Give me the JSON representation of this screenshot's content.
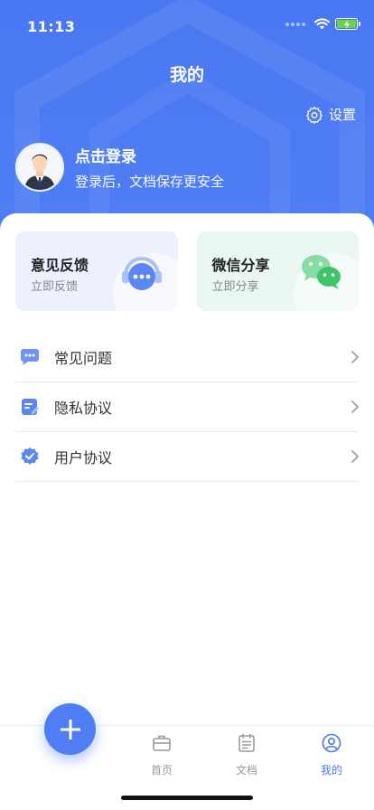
{
  "status_bar": {
    "time": "11:13"
  },
  "header": {
    "title": "我的",
    "settings_label": "设置"
  },
  "profile": {
    "title": "点击登录",
    "subtitle": "登录后，文档保存更安全"
  },
  "cards": [
    {
      "title": "意见反馈",
      "subtitle": "立即反馈",
      "icon": "headset-chat-icon"
    },
    {
      "title": "微信分享",
      "subtitle": "立即分享",
      "icon": "wechat-icon"
    }
  ],
  "menu": [
    {
      "label": "常见问题",
      "icon": "faq-chat-icon"
    },
    {
      "label": "隐私协议",
      "icon": "document-edit-icon"
    },
    {
      "label": "用户协议",
      "icon": "verified-badge-icon"
    }
  ],
  "tabs": [
    {
      "label": "首页",
      "icon": "briefcase-icon",
      "active": false
    },
    {
      "label": "文档",
      "icon": "calendar-doc-icon",
      "active": false
    },
    {
      "label": "我的",
      "icon": "user-circle-icon",
      "active": true
    }
  ],
  "colors": {
    "primary": "#4a78f2",
    "feedback_card_bg": "#edf1fd",
    "share_card_bg": "#e9f7f0",
    "wechat_green": "#3fc36a"
  }
}
